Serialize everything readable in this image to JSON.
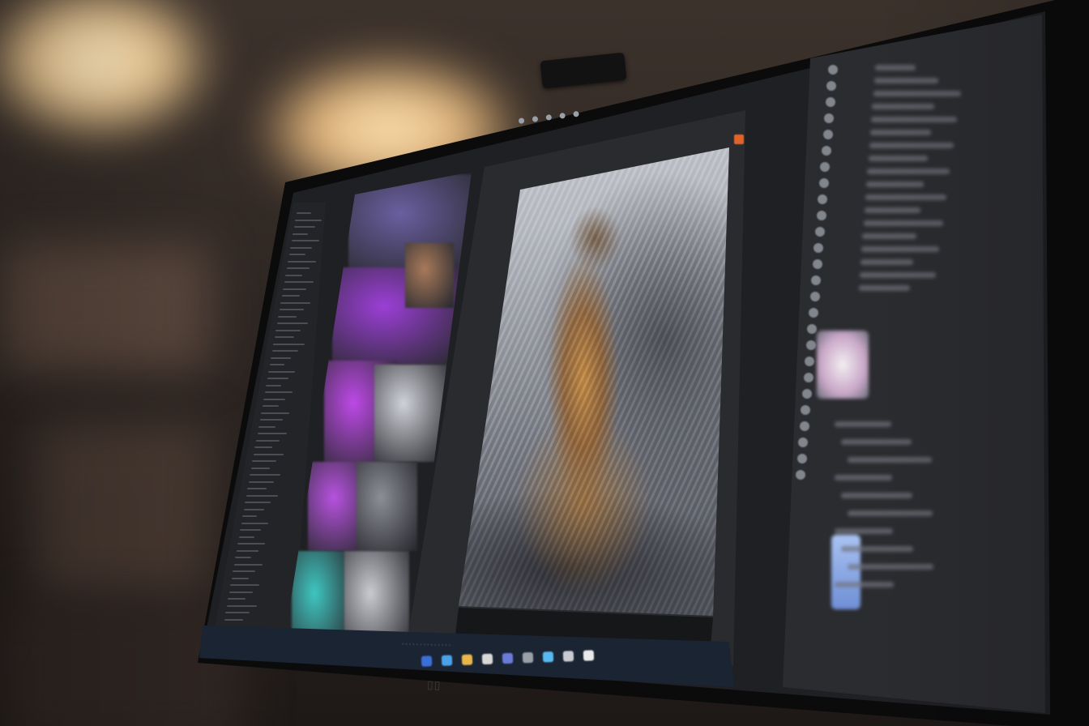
{
  "colors": {
    "ui_dark": "#1f2023",
    "panel": "#2b2c30",
    "accent_orange": "#e0642a",
    "taskbar": "#1b2433",
    "lamp_glow": "#f0c98e"
  },
  "icons": {
    "webcam": "webcam-icon",
    "accent": "color-swatch-icon",
    "tool": "tool-icon",
    "layer": "layer-thumb-icon",
    "taskbar_app": "taskbar-app-icon"
  },
  "taskbar_icon_colors": [
    "#3a6fd8",
    "#4aa3e8",
    "#e8b64a",
    "#d8d8d8",
    "#6a7ad8",
    "#9aa0a8",
    "#58b8f0",
    "#c8ccd2",
    "#eaeaea"
  ],
  "thumbnail_colors": [
    "#6a5fa0",
    "#9b3fd6",
    "#bd49e6",
    "#cfd2d8",
    "#b752df",
    "#8c8f96",
    "#3fc6c0",
    "#c9cbd0",
    "#a87a5a"
  ]
}
